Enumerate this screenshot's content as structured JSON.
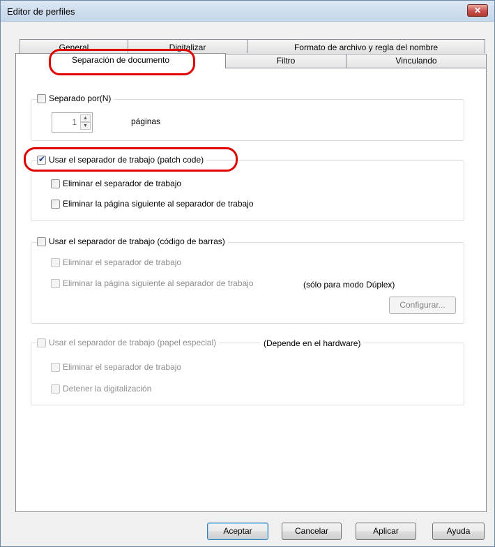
{
  "window": {
    "title": "Editor de perfiles",
    "close_glyph": "✕"
  },
  "tabs_back": [
    "General",
    "Digitalizar",
    "Formato de archivo y regla del nombre"
  ],
  "tabs_front": [
    "Separación de documento",
    "Filtro",
    "Vinculando"
  ],
  "section1": {
    "label": "Separado por(N)",
    "checked": false,
    "spin_value": "1",
    "unit": "páginas"
  },
  "section2": {
    "label": "Usar el separador de trabajo (patch code)",
    "checked": true,
    "opt1": "Eliminar el separador de trabajo",
    "opt2": "Eliminar la página siguiente al separador de trabajo"
  },
  "section3": {
    "label": "Usar el separador de trabajo (código de barras)",
    "checked": false,
    "opt1": "Eliminar el separador de trabajo",
    "opt2": "Eliminar la página siguiente al separador de trabajo",
    "note": "(sólo para modo Dúplex)",
    "config_button": "Configurar..."
  },
  "section4": {
    "label": "Usar el separador de trabajo (papel especial)",
    "note": "(Depende en el hardware)",
    "opt1": "Eliminar el separador de trabajo",
    "opt2": "Detener la digitalización"
  },
  "buttons": {
    "ok": "Aceptar",
    "cancel": "Cancelar",
    "apply": "Aplicar",
    "help": "Ayuda"
  },
  "colors": {
    "highlight": "#e00000"
  }
}
